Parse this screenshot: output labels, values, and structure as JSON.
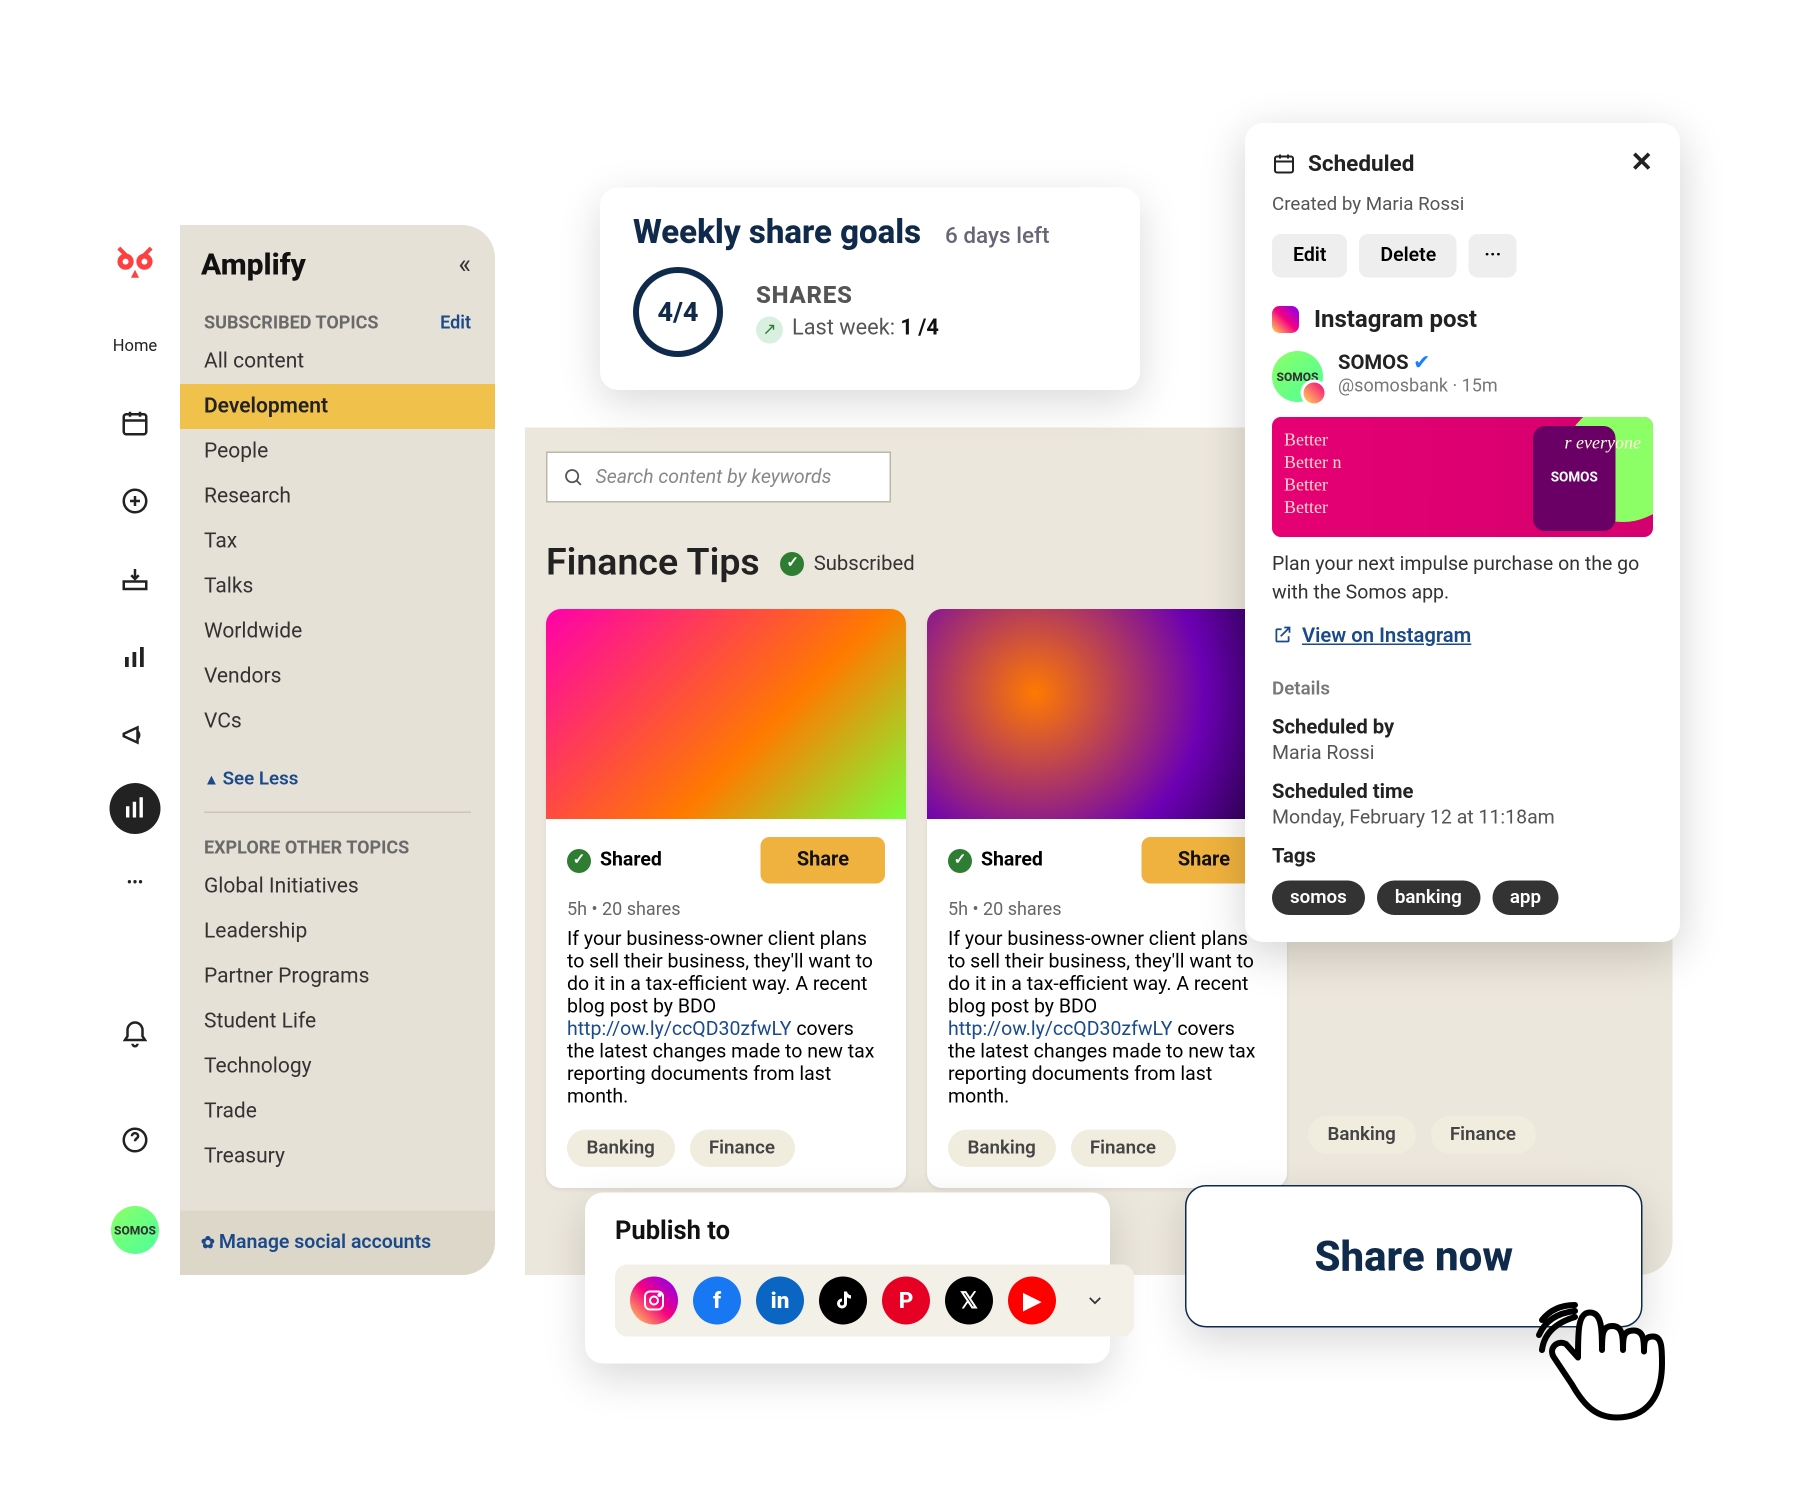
{
  "rail": {
    "home": "Home"
  },
  "sidebar": {
    "title": "Amplify",
    "subscribed_head": "SUBSCRIBED TOPICS",
    "edit": "Edit",
    "topics": [
      "All content",
      "Development",
      "People",
      "Research",
      "Tax",
      "Talks",
      "Worldwide",
      "Vendors",
      "VCs"
    ],
    "active_index": 1,
    "see_less": "See Less",
    "explore_head": "EXPLORE OTHER TOPICS",
    "explore": [
      "Global Initiatives",
      "Leadership",
      "Partner Programs",
      "Student Life",
      "Technology",
      "Trade",
      "Treasury"
    ],
    "manage": "Manage social accounts"
  },
  "search": {
    "placeholder": "Search content by keywords"
  },
  "section": {
    "title": "Finance Tips",
    "subscribed": "Subscribed"
  },
  "card": {
    "shared": "Shared",
    "share_btn": "Share",
    "meta": "5h  •  20 shares",
    "copy_pre": "If your business-owner client plans to sell their business, they'll want to do it in a tax-efficient way. A recent blog post by BDO ",
    "link": "http://ow.ly/ccQD30zfwLY",
    "copy_post": " covers the latest changes made to new tax reporting documents from last month.",
    "tag_a": "Banking",
    "tag_b": "Finance"
  },
  "goals": {
    "title": "Weekly share goals",
    "days_left": "6 days left",
    "ratio": "4/4",
    "shares_label": "SHARES",
    "last_week_label": "Last week: ",
    "last_week_value": "1 /4"
  },
  "sched": {
    "title": "Scheduled",
    "created_by": "Created by Maria Rossi",
    "edit": "Edit",
    "delete": "Delete",
    "more": "···",
    "ig_label": "Instagram post",
    "profile_name": "SOMOS",
    "profile_handle": "@somosbank · 15m",
    "caption": "Plan your next impulse purchase on the go with the Somos app.",
    "view_link": "View on Instagram",
    "details": "Details",
    "by_k": "Scheduled by",
    "by_v": "Maria Rossi",
    "time_k": "Scheduled time",
    "time_v": "Monday, February 12 at 11:18am",
    "tags_k": "Tags",
    "tags": [
      "somos",
      "banking",
      "app"
    ]
  },
  "publish": {
    "title": "Publish to"
  },
  "sharenow": "Share now"
}
